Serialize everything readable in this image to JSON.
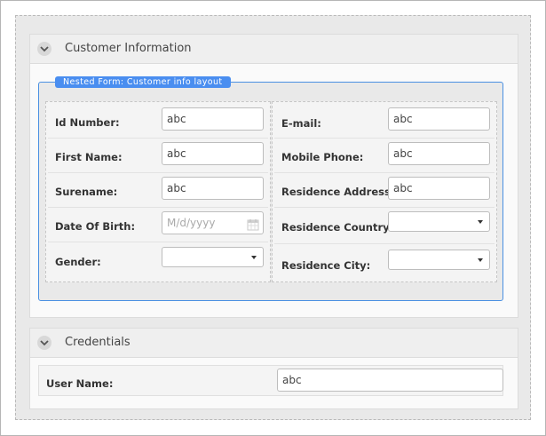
{
  "customer_info": {
    "title": "Customer Information",
    "nested_caption": "Nested Form: Customer info layout",
    "left_fields": [
      {
        "label": "Id Number:",
        "value": "abc"
      },
      {
        "label": "First Name:",
        "value": "abc"
      },
      {
        "label": "Surename:",
        "value": "abc"
      },
      {
        "label": "Date Of Birth:",
        "placeholder": "M/d/yyyy"
      },
      {
        "label": "Gender:",
        "value": ""
      }
    ],
    "right_fields": [
      {
        "label": "E-mail:",
        "value": "abc"
      },
      {
        "label": "Mobile Phone:",
        "value": "abc"
      },
      {
        "label": "Residence Address:",
        "value": "abc"
      },
      {
        "label": "Residence Country:",
        "value": ""
      },
      {
        "label": "Residence City:",
        "value": ""
      }
    ]
  },
  "credentials": {
    "title": "Credentials",
    "user_name_label": "User Name:",
    "user_name_value": "abc"
  },
  "colors": {
    "accent_blue": "#4a8ef0",
    "background": "#e9e9e9"
  },
  "icons": [
    "chevron-down-icon",
    "calendar-icon",
    "dropdown-caret-icon"
  ]
}
